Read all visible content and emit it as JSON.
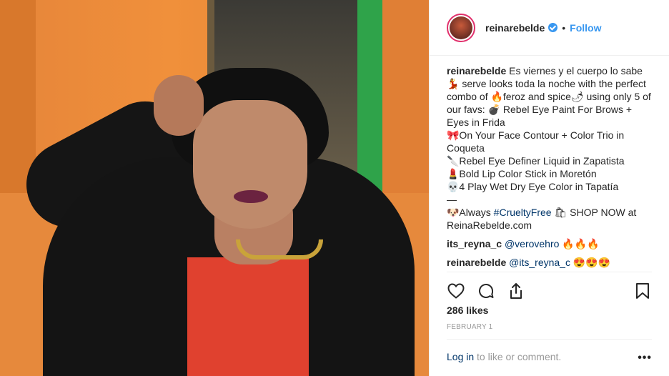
{
  "post": {
    "username": "reinarebelde",
    "follow_label": "Follow",
    "dot": "•",
    "caption": "Es viernes y el cuerpo lo sabe 💃 serve looks toda la noche with the perfect combo of 🔥feroz and spice🌶 using only 5 of our favs: 💣 Rebel Eye Paint For Brows + Eyes in Frida\n🎀On Your Face Contour + Color Trio in Coqueta\n🔪Rebel Eye Definer Liquid in Zapatista\n💄Bold Lip Color Stick in Moretón\n💀4 Play Wet Dry Eye Color in Tapatía\n—\n🐶Always ",
    "caption_hashtag": "#CrueltyFree",
    "caption_tail": "🛍 SHOP NOW at ReinaRebelde.com",
    "comments": [
      {
        "user": "its_reyna_c",
        "mention": "@verovehro",
        "text": " 🔥🔥🔥"
      },
      {
        "user": "reinarebelde",
        "mention": "@its_reyna_c",
        "text": " 😍😍😍"
      }
    ],
    "likes": "286 likes",
    "date": "FEBRUARY 1",
    "login_link": "Log in",
    "login_text": " to like or comment.",
    "more": "•••"
  },
  "icons": {
    "verified": "verified-badge-icon",
    "like": "heart-icon",
    "comment": "comment-icon",
    "share": "share-icon",
    "save": "bookmark-icon"
  },
  "colors": {
    "accent_blue": "#3897f0",
    "link": "#003569",
    "muted": "#999999"
  }
}
